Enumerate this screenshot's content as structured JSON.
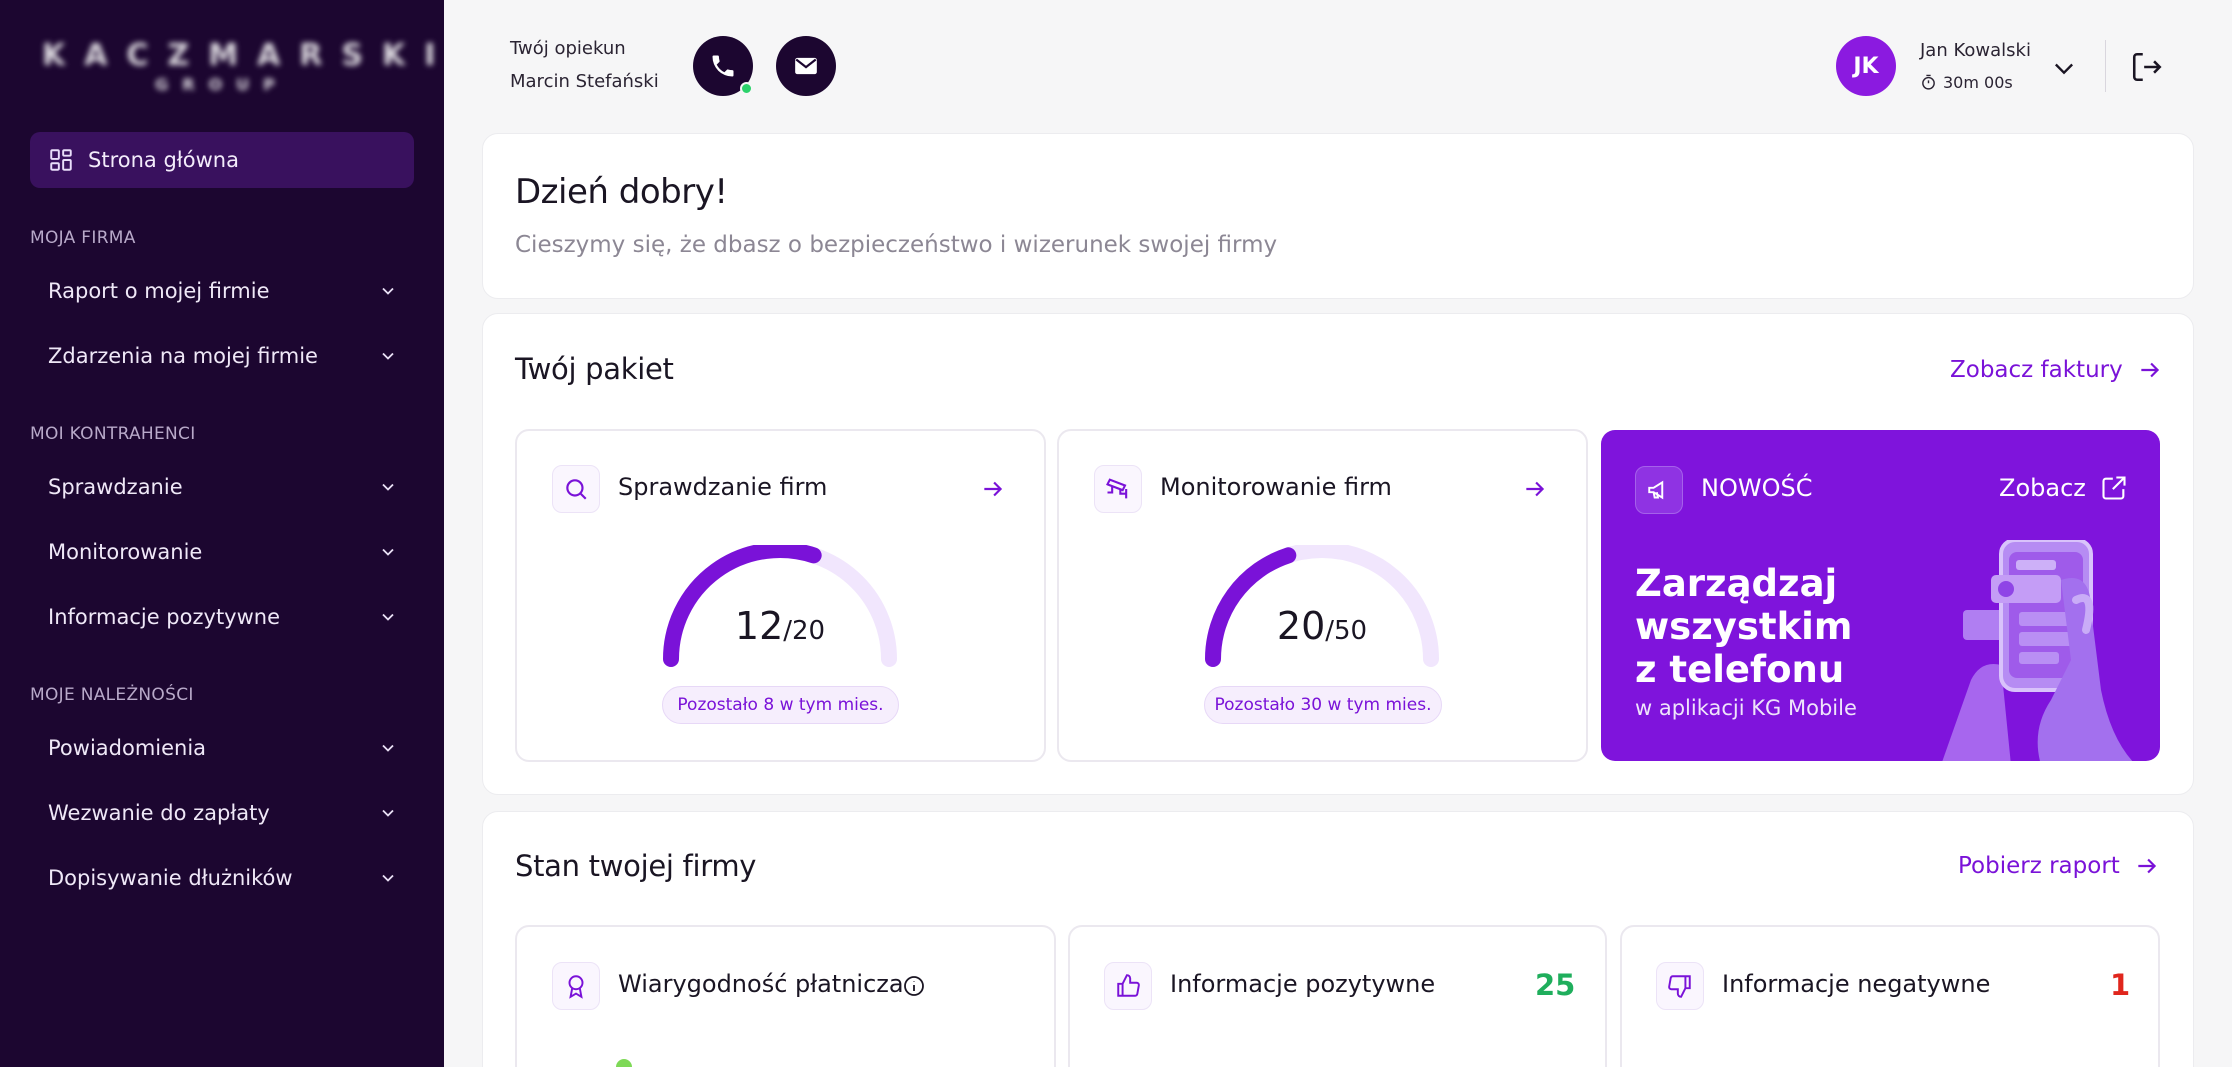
{
  "sidebar": {
    "logo_line1": "KACZMARSKI",
    "logo_line2": "GROUP",
    "home_label": "Strona główna",
    "sections": [
      {
        "title": "MOJA FIRMA",
        "items": [
          "Raport o mojej firmie",
          "Zdarzenia na mojej firmie"
        ]
      },
      {
        "title": "MOI KONTRAHENCI",
        "items": [
          "Sprawdzanie",
          "Monitorowanie",
          "Informacje pozytywne"
        ]
      },
      {
        "title": "MOJE NALEŻNOŚCI",
        "items": [
          "Powiadomienia",
          "Wezwanie do zapłaty",
          "Dopisywanie dłużników"
        ]
      }
    ]
  },
  "header": {
    "guardian_label": "Twój opiekun",
    "guardian_name": "Marcin Stefański",
    "user_initials": "JK",
    "user_name": "Jan Kowalski",
    "session_timer": "30m 00s",
    "online_color": "#2bd26b"
  },
  "greeting": {
    "title": "Dzień dobry!",
    "subtitle": "Cieszymy się, że dbasz o bezpieczeństwo i wizerunek swojej firmy"
  },
  "package": {
    "title": "Twój pakiet",
    "link": "Zobacz faktury",
    "cards": [
      {
        "title": "Sprawdzanie firm",
        "used": 12,
        "total": 20,
        "used_label": "12",
        "total_label": "/20",
        "remaining": "Pozostało 8 w tym mies.",
        "icon": "search-icon"
      },
      {
        "title": "Monitorowanie firm",
        "used": 20,
        "total": 50,
        "used_label": "20",
        "total_label": "/50",
        "remaining": "Pozostało 30 w tym mies.",
        "icon": "cctv-icon"
      }
    ],
    "promo": {
      "label": "NOWOŚĆ",
      "link": "Zobacz",
      "headline_1": "Zarządzaj",
      "headline_2": "wszystkim",
      "headline_3": "z telefonu",
      "sub": "w aplikacji KG Mobile",
      "icon": "megaphone-icon"
    }
  },
  "company_status": {
    "title": "Stan twojej firmy",
    "link": "Pobierz raport",
    "cards": [
      {
        "title": "Wiarygodność płatnicza",
        "icon": "award-icon"
      },
      {
        "title": "Informacje pozytywne",
        "count": "25",
        "icon": "thumbs-up-icon"
      },
      {
        "title": "Informacje negatywne",
        "count": "1",
        "icon": "thumbs-down-icon"
      }
    ]
  },
  "colors": {
    "sidebar_bg": "#1c0630",
    "accent": "#7a12d8",
    "positive": "#1fae5c",
    "negative": "#e0261d",
    "gauge_track": "#f1e6fd"
  }
}
